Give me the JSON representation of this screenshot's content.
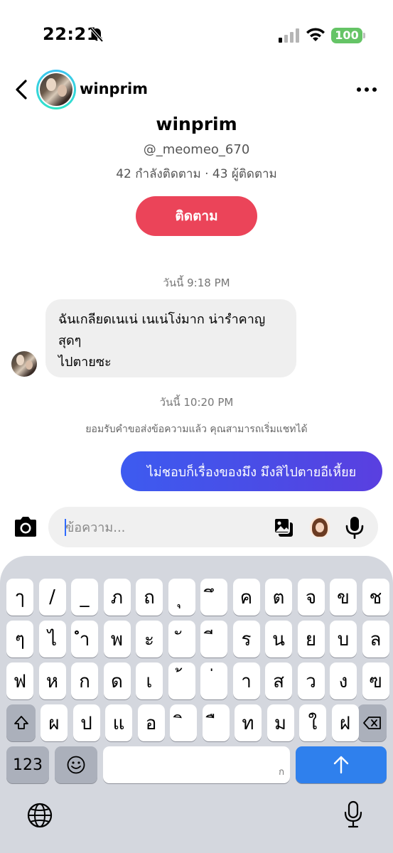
{
  "status_bar": {
    "time": "22:21",
    "battery": "100",
    "battery_color": "#65c466"
  },
  "header": {
    "username": "winprim",
    "back_icon": "chevron-left-icon",
    "more_icon": "more-horizontal-icon"
  },
  "profile": {
    "name": "winprim",
    "handle": "@_meomeo_670",
    "stats": "42 กำลังติดตาม · 43 ผู้ติดตาม",
    "follow_label": "ติดตาม",
    "follow_color": "#eb4459"
  },
  "chat": {
    "timestamp_1": "วันนี้ 9:18 PM",
    "incoming": {
      "line1": "ฉันเกลียดเนเน่ เนเน่โง่มาก น่ารำคาญ",
      "line2": "สุดๆ",
      "line3": "ไปตายซะ"
    },
    "timestamp_2": "วันนี้ 10:20 PM",
    "system_note": "ยอมรับคำขอส่งข้อความแล้ว คุณสามารถเริ่มแชทได้",
    "outgoing": "ไม่ชอบก็เรื่องของมึง มึงสิไปตายอีเหี้ยย"
  },
  "composer": {
    "placeholder": "ข้อความ...",
    "value": ""
  },
  "keyboard": {
    "row1": [
      "ๅ",
      "/",
      "_",
      "ภ",
      "ถ",
      "ุ",
      "ึ",
      "ค",
      "ต",
      "จ",
      "ข",
      "ช"
    ],
    "row2": [
      "ๆ",
      "ไ",
      "ำ",
      "พ",
      "ะ",
      "ั",
      "ี",
      "ร",
      "น",
      "ย",
      "บ",
      "ล"
    ],
    "row3": [
      "ฟ",
      "ห",
      "ก",
      "ด",
      "เ",
      "้",
      "่",
      "า",
      "ส",
      "ว",
      "ง",
      "ฃ"
    ],
    "row4": [
      "ผ",
      "ป",
      "แ",
      "อ",
      "ิ",
      "ื",
      "ท",
      "ม",
      "ใ",
      "ฝ"
    ],
    "numbers_label": "123",
    "space_hint": "ก",
    "send_color": "#2f80ed"
  }
}
